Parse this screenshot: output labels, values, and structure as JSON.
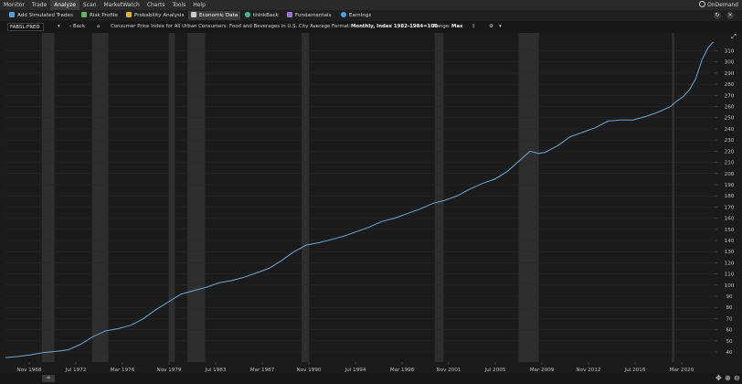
{
  "menu": {
    "items": [
      "Monitor",
      "Trade",
      "Analyze",
      "Scan",
      "MarketWatch",
      "Charts",
      "Tools",
      "Help"
    ],
    "active": "Analyze",
    "ondemand": "OnDemand"
  },
  "toolbar": {
    "tools": [
      {
        "label": "Add Simulated Trades",
        "icon": "trade-icon",
        "color": "#4aa3df"
      },
      {
        "label": "Risk Profile",
        "icon": "risk-profile-icon",
        "color": "#5cb85c"
      },
      {
        "label": "Probability Analysis",
        "icon": "probability-icon",
        "color": "#e0b030"
      },
      {
        "label": "Economic Data",
        "icon": "building-icon",
        "color": "#cccccc"
      },
      {
        "label": "thinkBack",
        "icon": "clock-icon",
        "color": "#3fb89a"
      },
      {
        "label": "Fundamentals",
        "icon": "fundamentals-icon",
        "color": "#a070e0"
      },
      {
        "label": "Earnings",
        "icon": "bulb-icon",
        "color": "#4aa3df"
      }
    ],
    "selected": "Economic Data"
  },
  "series_bar": {
    "symbol": "FABSL:FRED",
    "back": "Back",
    "title": "Consumer Price Index for All Urban Consumers: Food and Beverages in U.S. City Average",
    "format_label": "Format:",
    "format_value": "Monthly, Index 1982-1984=100",
    "range_label": "Range:",
    "range_value": "Max"
  },
  "chart_data": {
    "type": "line",
    "x_tick_labels": [
      "Nov 1968",
      "Jul 1972",
      "Mar 1976",
      "Nov 1979",
      "Jul 1983",
      "Mar 1987",
      "Nov 1990",
      "Jul 1994",
      "Mar 1998",
      "Nov 2001",
      "Jul 2005",
      "Mar 2009",
      "Nov 2012",
      "Jul 2016",
      "Mar 2020"
    ],
    "y_tick_labels": [
      40,
      50,
      60,
      70,
      80,
      90,
      100,
      110,
      120,
      130,
      140,
      150,
      160,
      170,
      180,
      190,
      200,
      210,
      220,
      230,
      240,
      250,
      260,
      270,
      280,
      290,
      300,
      310
    ],
    "ylim": [
      31,
      326
    ],
    "xlim": [
      1967.0,
      2023.5
    ],
    "recessions": [
      [
        1969.9,
        1970.9
      ],
      [
        1973.9,
        1975.2
      ],
      [
        1980.0,
        1980.5
      ],
      [
        1981.5,
        1982.9
      ],
      [
        1990.6,
        1991.2
      ],
      [
        2001.2,
        2001.9
      ],
      [
        2007.9,
        2009.5
      ],
      [
        2020.1,
        2020.3
      ]
    ],
    "points": [
      [
        1967.0,
        35
      ],
      [
        1968.0,
        36
      ],
      [
        1969.0,
        37.5
      ],
      [
        1970.0,
        39.5
      ],
      [
        1971.0,
        40.5
      ],
      [
        1972.0,
        42
      ],
      [
        1973.0,
        47
      ],
      [
        1974.0,
        54
      ],
      [
        1975.0,
        59
      ],
      [
        1976.0,
        61
      ],
      [
        1977.0,
        64
      ],
      [
        1978.0,
        70
      ],
      [
        1979.0,
        78
      ],
      [
        1980.0,
        85
      ],
      [
        1981.0,
        92
      ],
      [
        1982.0,
        95
      ],
      [
        1983.0,
        98
      ],
      [
        1984.0,
        102
      ],
      [
        1985.0,
        104
      ],
      [
        1986.0,
        107
      ],
      [
        1987.0,
        111
      ],
      [
        1988.0,
        115
      ],
      [
        1989.0,
        122
      ],
      [
        1990.0,
        130
      ],
      [
        1991.0,
        136
      ],
      [
        1992.0,
        138
      ],
      [
        1993.0,
        141
      ],
      [
        1994.0,
        144
      ],
      [
        1995.0,
        148
      ],
      [
        1996.0,
        152
      ],
      [
        1997.0,
        157
      ],
      [
        1998.0,
        160
      ],
      [
        1999.0,
        164
      ],
      [
        2000.0,
        168
      ],
      [
        2001.0,
        173
      ],
      [
        2002.0,
        176
      ],
      [
        2003.0,
        180
      ],
      [
        2004.0,
        186
      ],
      [
        2005.0,
        191
      ],
      [
        2006.0,
        195
      ],
      [
        2007.0,
        202
      ],
      [
        2008.0,
        212
      ],
      [
        2008.8,
        220
      ],
      [
        2009.5,
        218
      ],
      [
        2010.0,
        219
      ],
      [
        2011.0,
        225
      ],
      [
        2012.0,
        233
      ],
      [
        2013.0,
        237
      ],
      [
        2014.0,
        241
      ],
      [
        2015.0,
        247
      ],
      [
        2016.0,
        248
      ],
      [
        2017.0,
        248
      ],
      [
        2018.0,
        251
      ],
      [
        2019.0,
        255
      ],
      [
        2020.0,
        260
      ],
      [
        2020.5,
        265
      ],
      [
        2021.0,
        269
      ],
      [
        2021.5,
        275
      ],
      [
        2022.0,
        285
      ],
      [
        2022.5,
        302
      ],
      [
        2023.0,
        313
      ],
      [
        2023.4,
        318
      ]
    ],
    "colors": {
      "line": "#6aa8d8",
      "recession": "#2e2e2e",
      "grid": "#2a2a2a",
      "tick": "#bdbdbd"
    }
  }
}
